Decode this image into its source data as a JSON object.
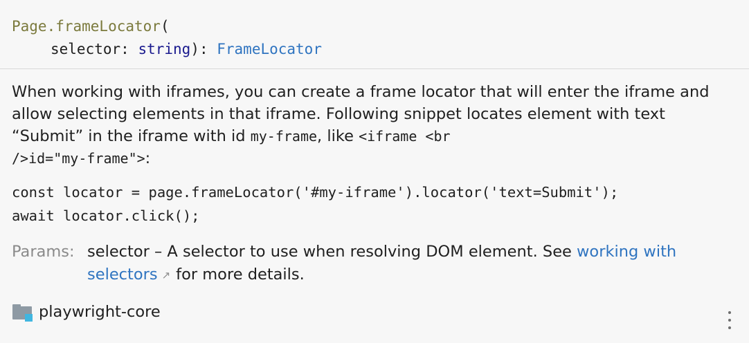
{
  "signature": {
    "owner": "Page.",
    "method": "frameLocator",
    "open_paren": "(",
    "param_name": "selector",
    "colon": ": ",
    "param_type": "string",
    "close": "): ",
    "return_type": "FrameLocator"
  },
  "description": {
    "part1": "When working with iframes, you can create a frame locator that will enter the iframe and allow selecting elements in that iframe. Following snippet locates element with text “Submit” in the iframe with id ",
    "code_id": "my-frame",
    "part2": ", like ",
    "code_tag1": "<iframe <br",
    "code_tag2": "/>id=\"my-frame\">",
    "part3": ":"
  },
  "code": {
    "line1": "const locator = page.frameLocator('#my-iframe').locator('text=Submit');",
    "line2": "await locator.click();"
  },
  "params": {
    "label": "Params:",
    "text_before": "selector – A selector to use when resolving DOM element. See ",
    "link_text": "working with selectors",
    "external_icon": "↗",
    "text_after": "for more details."
  },
  "footer": {
    "module": "playwright-core",
    "icon": "library-folder-icon"
  },
  "colors": {
    "accent": "#2f74c0",
    "background": "#f7f7f7"
  }
}
